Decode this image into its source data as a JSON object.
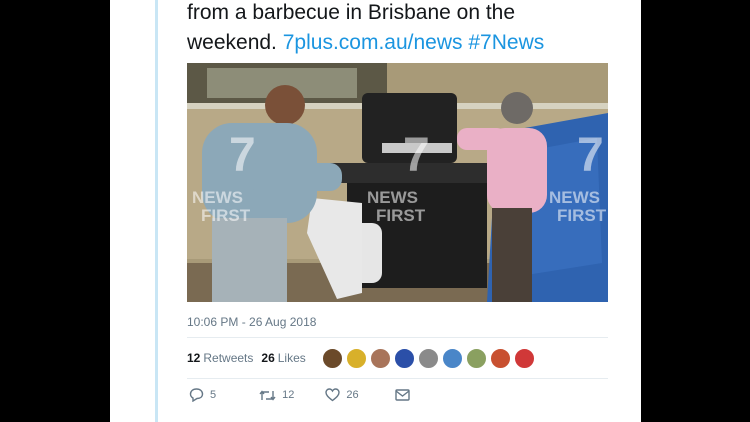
{
  "tweet": {
    "text_line1": "from a barbecue in Brisbane on the",
    "text_line2_plain": "weekend.",
    "link1": "7plus.com.au/news",
    "hashtag": "#7News"
  },
  "media": {
    "watermark_left": [
      "NEWS",
      "FIRST"
    ],
    "watermark_center": [
      "NEWS",
      "FIRST"
    ],
    "watermark_right": [
      "NEWS",
      "FIRST"
    ]
  },
  "timestamp": "10:06 PM - 26 Aug 2018",
  "stats": {
    "retweets_count": "12",
    "retweets_label": "Retweets",
    "likes_count": "26",
    "likes_label": "Likes"
  },
  "avatars": [
    {
      "name": "avatar-1",
      "color": "#6b4a2a"
    },
    {
      "name": "avatar-2",
      "color": "#d8b02a"
    },
    {
      "name": "avatar-3",
      "color": "#a8745a"
    },
    {
      "name": "avatar-4",
      "color": "#2b4fa8"
    },
    {
      "name": "avatar-5",
      "color": "#8a8a8a"
    },
    {
      "name": "avatar-6",
      "color": "#4a86c8"
    },
    {
      "name": "avatar-7",
      "color": "#8aa060"
    },
    {
      "name": "avatar-8",
      "color": "#c85030"
    },
    {
      "name": "avatar-9",
      "color": "#d03838"
    }
  ],
  "actions": {
    "reply_count": "5",
    "retweet_count": "12",
    "like_count": "26"
  },
  "colors": {
    "link": "#1b95e0",
    "rail": "#c9e6f5",
    "muted": "#657786"
  }
}
